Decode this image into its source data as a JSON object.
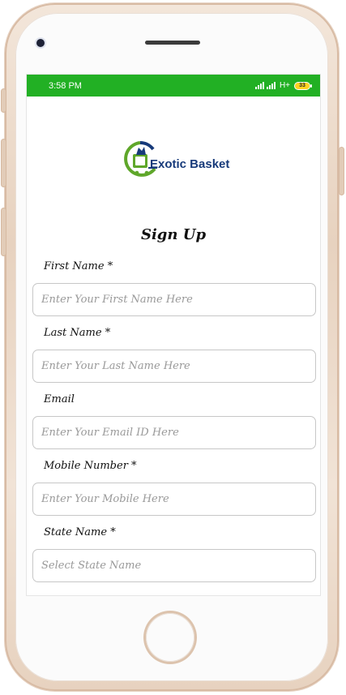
{
  "status_bar": {
    "time": "3:58 PM",
    "network": "H+",
    "battery_level": "33",
    "background_color": "#22b024"
  },
  "branding": {
    "logo_icon": "shopping-basket-icon",
    "name": "Exotic Basket",
    "brand_color": "#173a7a",
    "accent_color": "#5fa72a"
  },
  "signup": {
    "title": "Sign Up",
    "fields": [
      {
        "label": "First Name *",
        "placeholder": "Enter Your First Name Here",
        "value": ""
      },
      {
        "label": "Last Name *",
        "placeholder": "Enter Your Last Name Here",
        "value": ""
      },
      {
        "label": "Email",
        "placeholder": "Enter Your Email ID Here",
        "value": ""
      },
      {
        "label": "Mobile Number *",
        "placeholder": "Enter Your Mobile Here",
        "value": ""
      },
      {
        "label": "State Name *",
        "placeholder": "Select State Name",
        "value": ""
      }
    ]
  }
}
